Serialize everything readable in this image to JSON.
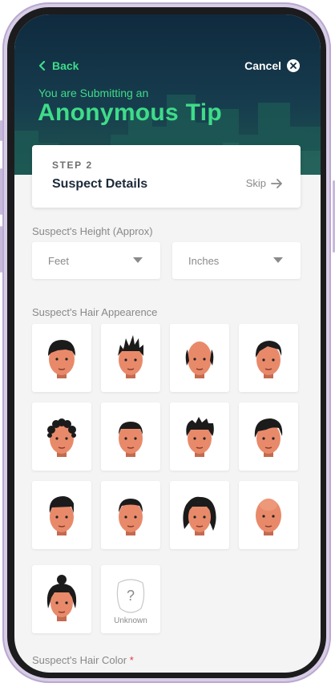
{
  "nav": {
    "back_label": "Back",
    "cancel_label": "Cancel"
  },
  "header": {
    "subtitle": "You are Submitting an",
    "title": "Anonymous Tip"
  },
  "step": {
    "label": "STEP 2",
    "title": "Suspect Details",
    "skip_label": "Skip"
  },
  "height": {
    "label": "Suspect's Height (Approx)",
    "feet_value": "Feet",
    "inches_value": "Inches"
  },
  "hair": {
    "label": "Suspect's Hair Appearence",
    "styles": [
      "bowl-cut",
      "spiky",
      "balding",
      "side-part",
      "curly",
      "short-crop",
      "messy-textured",
      "long-swept",
      "quiff",
      "slicked-back",
      "shoulder-length-wavy",
      "bald",
      "top-bun",
      "unknown"
    ],
    "unknown_label": "Unknown"
  },
  "hair_color": {
    "label": "Suspect's Hair Color",
    "required_mark": "*"
  },
  "colors": {
    "accent": "#3fdc8a",
    "hero_bg": "#0f2a3e",
    "required": "#e8343f"
  }
}
